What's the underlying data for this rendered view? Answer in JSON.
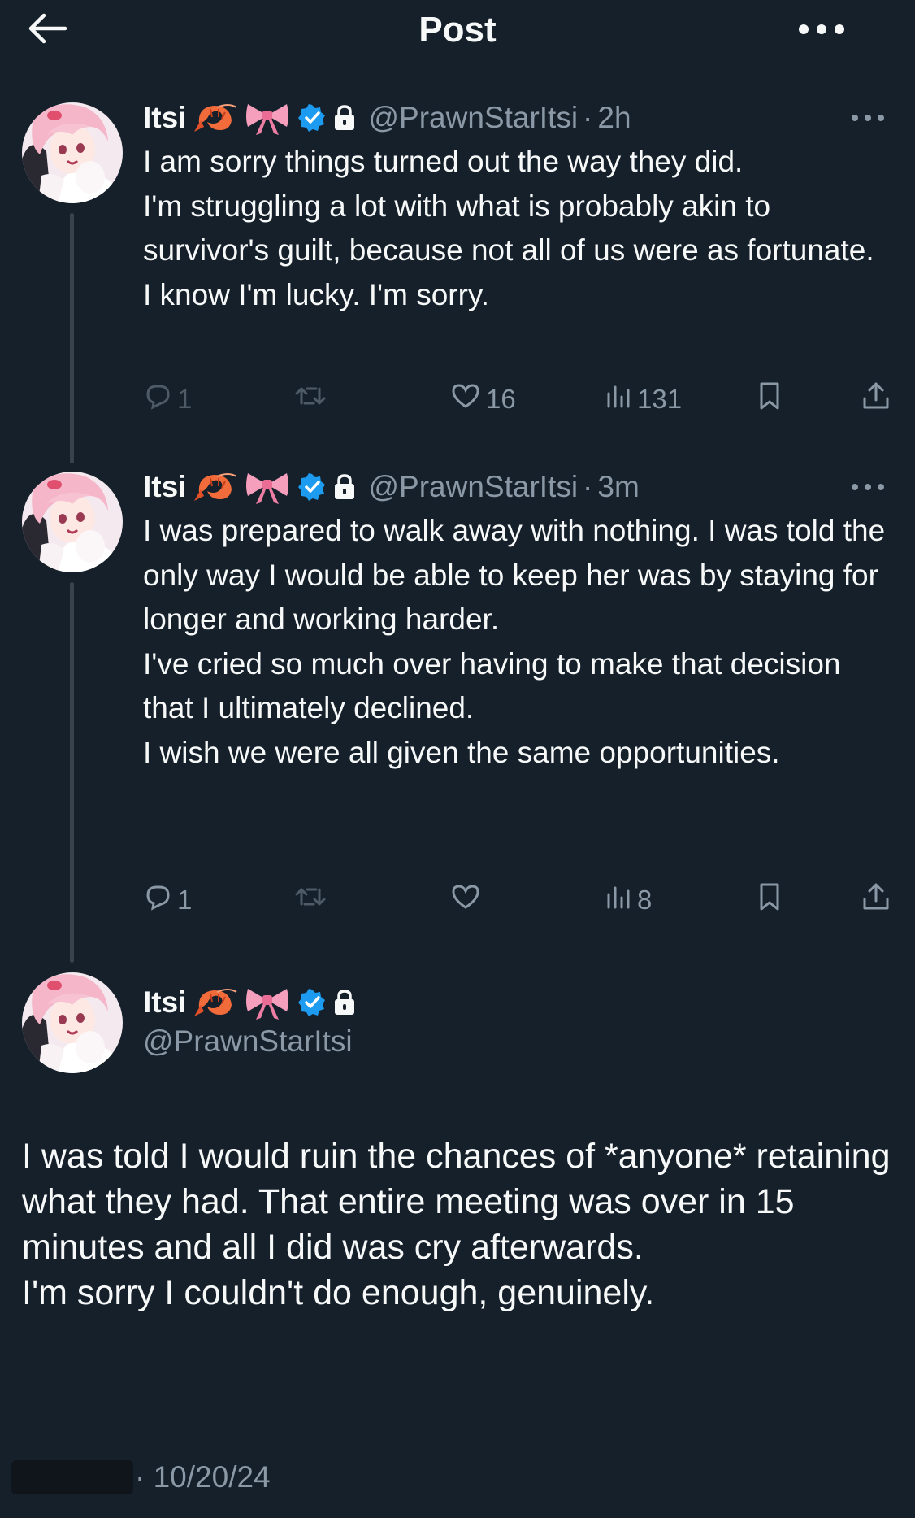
{
  "header": {
    "title": "Post",
    "back_icon": "arrow-left-icon",
    "more_icon": "more-horizontal-icon"
  },
  "colors": {
    "background": "#15202b",
    "text": "#f7f9f9",
    "secondary": "#8b98a5",
    "verified": "#1d9bf0",
    "thread_line": "#38444d"
  },
  "tweets": [
    {
      "display_name": "Itsi",
      "badges": [
        "shrimp-emoji",
        "ribbon-emoji",
        "verified-icon",
        "lock-icon"
      ],
      "handle": "@PrawnStarItsi",
      "sep": "·",
      "time": "2h",
      "text": "I am sorry things turned out the way they did.\nI'm struggling a lot with what is probably akin to survivor's guilt, because not all of us were as fortunate.\nI know I'm lucky. I'm sorry.",
      "replies": "1",
      "reposts": "",
      "likes": "16",
      "views": "131"
    },
    {
      "display_name": "Itsi",
      "badges": [
        "shrimp-emoji",
        "ribbon-emoji",
        "verified-icon",
        "lock-icon"
      ],
      "handle": "@PrawnStarItsi",
      "sep": "·",
      "time": "3m",
      "text": "I was prepared to walk away with nothing. I was told the only way I would be able to keep her was by staying for longer and working harder.\nI've cried so much over having to make that decision that I ultimately declined.\nI wish we were all given the same opportunities.",
      "replies": "1",
      "reposts": "",
      "likes": "",
      "views": "8"
    }
  ],
  "focus": {
    "display_name": "Itsi",
    "badges": [
      "shrimp-emoji",
      "ribbon-emoji",
      "verified-icon",
      "lock-icon"
    ],
    "handle": "@PrawnStarItsi",
    "text": "I was told I would ruin the chances of *anyone* retaining what they had. That entire meeting was over in 15 minutes and all I did was cry afterwards.\nI'm sorry I couldn't do enough, genuinely.",
    "date": "· 10/20/24"
  }
}
